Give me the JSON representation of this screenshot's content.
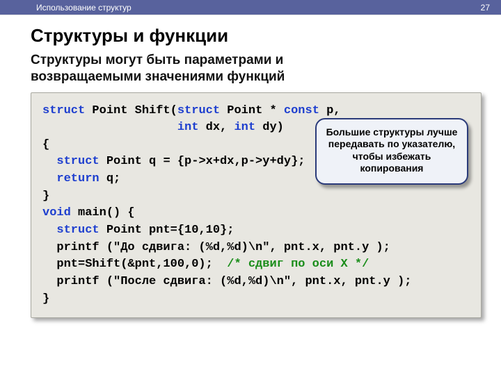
{
  "header": {
    "breadcrumb": "Использование структур",
    "page_number": "27"
  },
  "slide": {
    "title": "Структуры и функции",
    "subtitle_line1": "Структуры могут быть параметрами и",
    "subtitle_line2": "возвращаемыми значениями функций"
  },
  "code": {
    "kw_struct": "struct",
    "kw_const": "const",
    "kw_int": "int",
    "kw_return": "return",
    "kw_void": "void",
    "l1_a": " Point Shift(",
    "l1_b": " Point * ",
    "l1_c": " p,",
    "l2_a": "                   ",
    "l2_b": " dx, ",
    "l2_c": " dy)",
    "l3": "{",
    "l4_a": "  ",
    "l4_b": " Point q = {p->x+dx,p->y+dy};",
    "l5_a": "  ",
    "l5_b": " q;",
    "l6": "}",
    "l7_a": " main() {",
    "l8_a": "  ",
    "l8_b": " Point pnt={10,10};",
    "l9": "  printf (\"До сдвига: (%d,%d)\\n\", pnt.x, pnt.y );",
    "l10_a": "  pnt=Shift(&pnt,100,0);  ",
    "l10_b": "/* сдвиг по оси X */",
    "l11": "  printf (\"После сдвига: (%d,%d)\\n\", pnt.x, pnt.y );",
    "l12": "}"
  },
  "callout": {
    "text": "Большие структуры лучше передавать по указателю, чтобы избежать копирования"
  }
}
